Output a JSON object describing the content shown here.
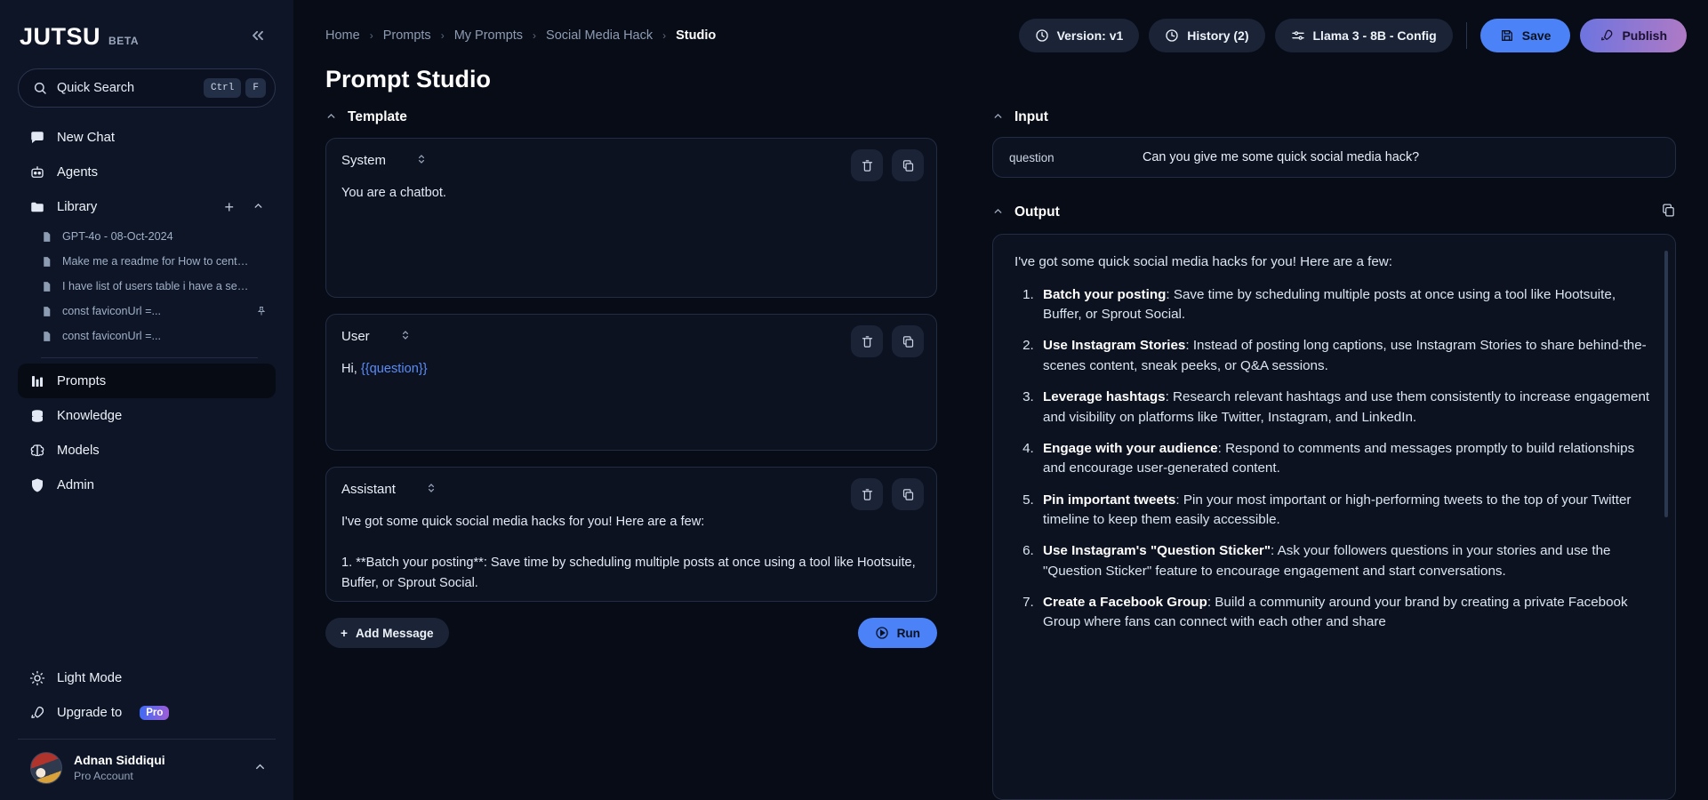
{
  "sidebar": {
    "logo": "JUTSU",
    "logo_badge": "BETA",
    "collapse_icon": "chevrons-left-icon",
    "search": {
      "label": "Quick Search",
      "kbd1": "Ctrl",
      "kbd2": "F",
      "icon": "search-icon"
    },
    "nav": [
      {
        "label": "New Chat",
        "icon": "chat-bubble-icon",
        "active": false
      },
      {
        "label": "Agents",
        "icon": "robot-icon",
        "active": false
      }
    ],
    "library": {
      "label": "Library",
      "icon": "folder-icon",
      "add_icon": "plus-icon",
      "collapse_icon": "chevron-up-icon",
      "items": [
        {
          "label": "GPT-4o - 08-Oct-2024",
          "pinned": false
        },
        {
          "label": "Make me a readme for How to center a...",
          "pinned": false
        },
        {
          "label": "I have list of users table i have a sectio...",
          "pinned": false
        },
        {
          "label": "const faviconUrl =...",
          "pinned": true
        },
        {
          "label": "const faviconUrl =...",
          "pinned": false
        }
      ]
    },
    "nav2": [
      {
        "label": "Prompts",
        "icon": "chart-bar-icon",
        "active": true
      },
      {
        "label": "Knowledge",
        "icon": "database-icon",
        "active": false
      },
      {
        "label": "Models",
        "icon": "brain-icon",
        "active": false
      },
      {
        "label": "Admin",
        "icon": "shield-icon",
        "active": false
      }
    ],
    "bottom": [
      {
        "label": "Light Mode",
        "icon": "sun-icon"
      },
      {
        "label": "Upgrade to",
        "icon": "rocket-icon",
        "badge": "Pro"
      }
    ],
    "account": {
      "name": "Adnan Siddiqui",
      "subtitle": "Pro Account",
      "chevron": "chevron-up-icon"
    }
  },
  "header": {
    "breadcrumbs": [
      "Home",
      "Prompts",
      "My Prompts",
      "Social Media Hack",
      "Studio"
    ],
    "page_title": "Prompt Studio",
    "actions": {
      "version": {
        "label": "Version: v1",
        "icon": "clock-icon"
      },
      "history": {
        "label": "History (2)",
        "icon": "history-icon"
      },
      "config": {
        "label": "Llama 3 - 8B - Config",
        "icon": "sliders-icon"
      },
      "save": {
        "label": "Save",
        "icon": "save-icon"
      },
      "publish": {
        "label": "Publish",
        "icon": "rocket-icon"
      }
    }
  },
  "template": {
    "section_label": "Template",
    "messages": [
      {
        "role": "System",
        "content": "You are a chatbot.",
        "delete_icon": "trash-icon",
        "copy_icon": "copy-icon"
      },
      {
        "role": "User",
        "content_prefix": "Hi, ",
        "content_var": "{{question}}",
        "delete_icon": "trash-icon",
        "copy_icon": "copy-icon"
      },
      {
        "role": "Assistant",
        "content": "I've got some quick social media hacks for you! Here are a few:\n\n1. **Batch your posting**: Save time by scheduling multiple posts at once using a tool like Hootsuite, Buffer, or Sprout Social.",
        "delete_icon": "trash-icon",
        "copy_icon": "copy-icon"
      }
    ],
    "add_message": {
      "label": "Add Message",
      "icon": "plus-icon"
    },
    "run": {
      "label": "Run",
      "icon": "play-circle-icon"
    }
  },
  "input": {
    "section_label": "Input",
    "rows": [
      {
        "key": "question",
        "value": "Can you give me some quick social media hack?"
      }
    ]
  },
  "output": {
    "section_label": "Output",
    "copy_icon": "copy-icon",
    "lead": "I've got some quick social media hacks for you! Here are a few:",
    "items": [
      {
        "title": "Batch your posting",
        "body": ": Save time by scheduling multiple posts at once using a tool like Hootsuite, Buffer, or Sprout Social."
      },
      {
        "title": "Use Instagram Stories",
        "body": ": Instead of posting long captions, use Instagram Stories to share behind-the-scenes content, sneak peeks, or Q&A sessions."
      },
      {
        "title": "Leverage hashtags",
        "body": ": Research relevant hashtags and use them consistently to increase engagement and visibility on platforms like Twitter, Instagram, and LinkedIn."
      },
      {
        "title": "Engage with your audience",
        "body": ": Respond to comments and messages promptly to build relationships and encourage user-generated content."
      },
      {
        "title": "Pin important tweets",
        "body": ": Pin your most important or high-performing tweets to the top of your Twitter timeline to keep them easily accessible."
      },
      {
        "title": "Use Instagram's \"Question Sticker\"",
        "body": ": Ask your followers questions in your stories and use the \"Question Sticker\" feature to encourage engagement and start conversations."
      },
      {
        "title": "Create a Facebook Group",
        "body": ": Build a community around your brand by creating a private Facebook Group where fans can connect with each other and share"
      }
    ]
  },
  "colors": {
    "accent_blue": "#4c82f7",
    "sidebar_bg": "#0e1526",
    "page_bg": "#080c16",
    "card_bg": "#0c1220",
    "border": "#222c43",
    "var_token": "#5b8cf8"
  }
}
